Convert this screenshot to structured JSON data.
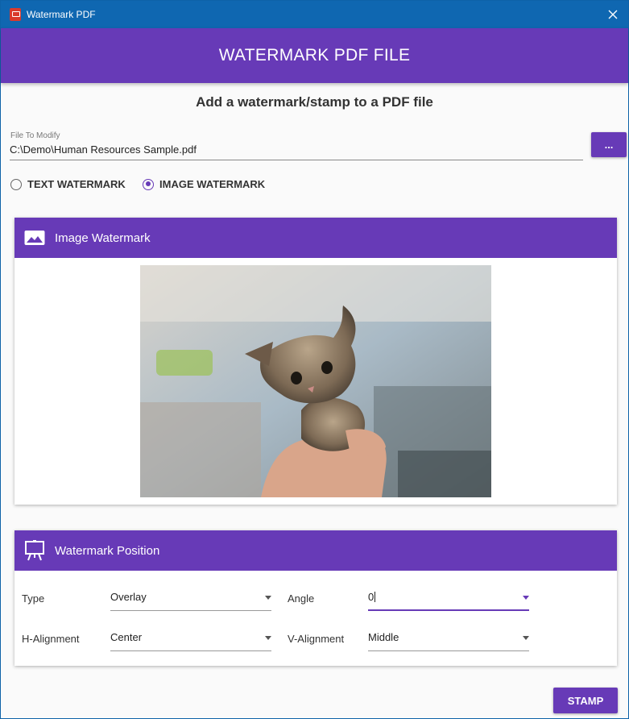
{
  "window": {
    "title": "Watermark PDF"
  },
  "header": {
    "title": "WATERMARK PDF FILE"
  },
  "subtitle": "Add a watermark/stamp to a PDF file",
  "file": {
    "label": "File To Modify",
    "value": "C:\\Demo\\Human Resources Sample.pdf",
    "browse_label": "..."
  },
  "watermark_type": {
    "options": [
      {
        "label": "TEXT WATERMARK",
        "checked": false
      },
      {
        "label": "IMAGE WATERMARK",
        "checked": true
      }
    ]
  },
  "image_card": {
    "title": "Image Watermark",
    "icon": "image-icon"
  },
  "position_card": {
    "title": "Watermark Position",
    "icon": "easel-icon",
    "fields": {
      "type": {
        "label": "Type",
        "value": "Overlay"
      },
      "angle": {
        "label": "Angle",
        "value": "0"
      },
      "h_alignment": {
        "label": "H-Alignment",
        "value": "Center"
      },
      "v_alignment": {
        "label": "V-Alignment",
        "value": "Middle"
      }
    }
  },
  "actions": {
    "stamp_label": "STAMP"
  },
  "colors": {
    "accent": "#673ab7",
    "titlebar": "#0f67b1"
  }
}
